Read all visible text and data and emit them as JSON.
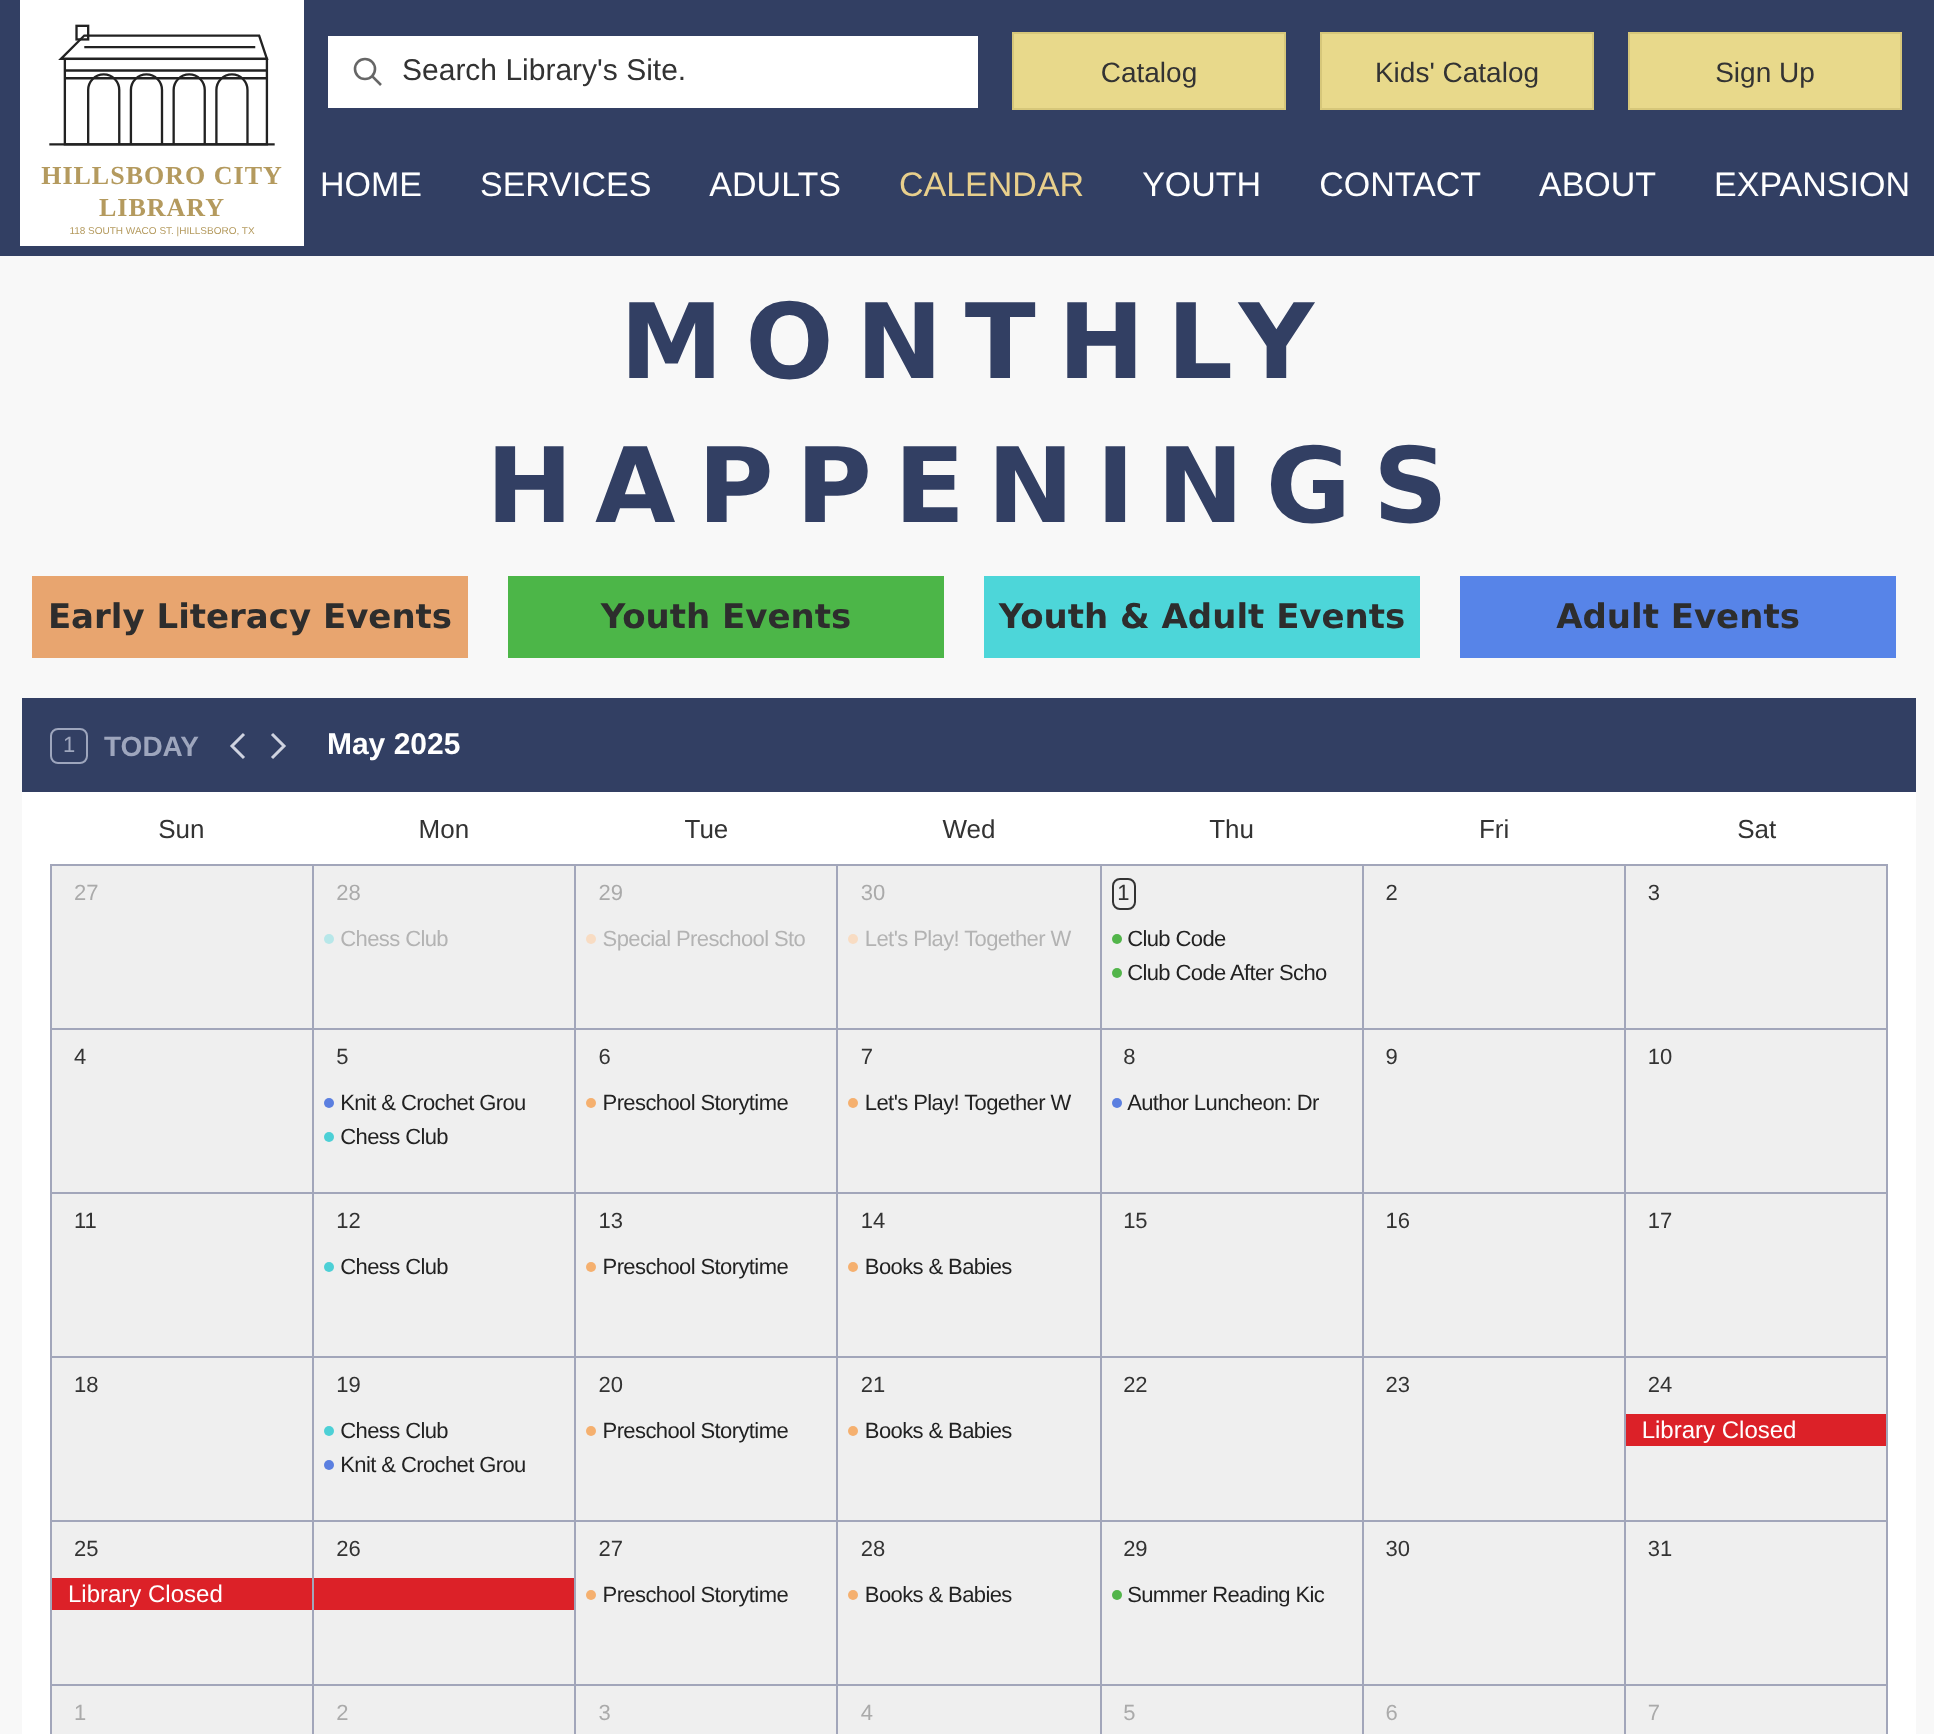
{
  "header": {
    "logo": {
      "line1": "HILLSBORO CITY",
      "line2": "LIBRARY",
      "address": "118 SOUTH WACO ST. |HILLSBORO, TX"
    },
    "search": {
      "placeholder": "Search Library's Site."
    },
    "buttons": [
      "Catalog",
      "Kids' Catalog",
      "Sign Up"
    ],
    "nav": [
      {
        "label": "HOME",
        "selected": false
      },
      {
        "label": "SERVICES",
        "selected": false
      },
      {
        "label": "ADULTS",
        "selected": false
      },
      {
        "label": "CALENDAR",
        "selected": true
      },
      {
        "label": "YOUTH",
        "selected": false
      },
      {
        "label": "CONTACT",
        "selected": false
      },
      {
        "label": "ABOUT",
        "selected": false
      },
      {
        "label": "EXPANSION",
        "selected": false
      }
    ]
  },
  "title_lines": [
    "MONTHLY",
    "HAPPENINGS"
  ],
  "legend": [
    {
      "label": "Early Literacy Events",
      "color": "#e8a56f"
    },
    {
      "label": "Youth Events",
      "color": "#4cb648"
    },
    {
      "label": "Youth & Adult Events",
      "color": "#4dd6d9"
    },
    {
      "label": "Adult Events",
      "color": "#5784e8"
    }
  ],
  "calendar": {
    "today_badge": "1",
    "today_label": "TODAY",
    "month": "May 2025",
    "weekdays": [
      "Sun",
      "Mon",
      "Tue",
      "Wed",
      "Thu",
      "Fri",
      "Sat"
    ],
    "weeks": [
      {
        "days": [
          {
            "date": "27",
            "outside": true,
            "today": false
          },
          {
            "date": "28",
            "outside": true,
            "today": false,
            "events": [
              {
                "title": "Chess Club",
                "color": "#b7e7e9"
              }
            ]
          },
          {
            "date": "29",
            "outside": true,
            "today": false,
            "events": [
              {
                "title": "Special Preschool Sto",
                "color": "#f8dcc3"
              }
            ]
          },
          {
            "date": "30",
            "outside": true,
            "today": false,
            "events": [
              {
                "title": "Let's Play! Together W",
                "color": "#f8dcc3"
              }
            ]
          },
          {
            "date": "1",
            "outside": false,
            "today": true,
            "events": [
              {
                "title": "Club Code",
                "color": "#52b54a"
              },
              {
                "title": "Club Code After Scho",
                "color": "#52b54a"
              }
            ]
          },
          {
            "date": "2",
            "outside": false,
            "today": false
          },
          {
            "date": "3",
            "outside": false,
            "today": false
          }
        ]
      },
      {
        "days": [
          {
            "date": "4",
            "outside": false,
            "today": false
          },
          {
            "date": "5",
            "outside": false,
            "today": false,
            "events": [
              {
                "title": "Knit & Crochet Grou",
                "color": "#5b7fe0"
              },
              {
                "title": "Chess Club",
                "color": "#4dd0d6"
              }
            ]
          },
          {
            "date": "6",
            "outside": false,
            "today": false,
            "events": [
              {
                "title": "Preschool Storytime",
                "color": "#f5b06f"
              }
            ]
          },
          {
            "date": "7",
            "outside": false,
            "today": false,
            "events": [
              {
                "title": "Let's Play! Together W",
                "color": "#f5b06f"
              }
            ]
          },
          {
            "date": "8",
            "outside": false,
            "today": false,
            "events": [
              {
                "title": "Author Luncheon: Dr",
                "color": "#5b7fe0"
              }
            ]
          },
          {
            "date": "9",
            "outside": false,
            "today": false
          },
          {
            "date": "10",
            "outside": false,
            "today": false
          }
        ]
      },
      {
        "days": [
          {
            "date": "11",
            "outside": false,
            "today": false
          },
          {
            "date": "12",
            "outside": false,
            "today": false,
            "events": [
              {
                "title": "Chess Club",
                "color": "#4dd0d6"
              }
            ]
          },
          {
            "date": "13",
            "outside": false,
            "today": false,
            "events": [
              {
                "title": "Preschool Storytime",
                "color": "#f5b06f"
              }
            ]
          },
          {
            "date": "14",
            "outside": false,
            "today": false,
            "events": [
              {
                "title": "Books & Babies",
                "color": "#f5b06f"
              }
            ]
          },
          {
            "date": "15",
            "outside": false,
            "today": false
          },
          {
            "date": "16",
            "outside": false,
            "today": false
          },
          {
            "date": "17",
            "outside": false,
            "today": false
          }
        ]
      },
      {
        "days": [
          {
            "date": "18",
            "outside": false,
            "today": false
          },
          {
            "date": "19",
            "outside": false,
            "today": false,
            "events": [
              {
                "title": "Chess Club",
                "color": "#4dd0d6"
              },
              {
                "title": "Knit & Crochet Grou",
                "color": "#5b7fe0"
              }
            ]
          },
          {
            "date": "20",
            "outside": false,
            "today": false,
            "events": [
              {
                "title": "Preschool Storytime",
                "color": "#f5b06f"
              }
            ]
          },
          {
            "date": "21",
            "outside": false,
            "today": false,
            "events": [
              {
                "title": "Books & Babies",
                "color": "#f5b06f"
              }
            ]
          },
          {
            "date": "22",
            "outside": false,
            "today": false
          },
          {
            "date": "23",
            "outside": false,
            "today": false
          },
          {
            "date": "24",
            "outside": false,
            "today": false,
            "banner": {
              "title": "Library Closed"
            }
          }
        ]
      },
      {
        "days": [
          {
            "date": "25",
            "outside": false,
            "today": false,
            "banner": {
              "title": "Library Closed"
            }
          },
          {
            "date": "26",
            "outside": false,
            "today": false,
            "banner": {
              "continued": true
            }
          },
          {
            "date": "27",
            "outside": false,
            "today": false,
            "events": [
              {
                "title": "Preschool Storytime",
                "color": "#f5b06f"
              }
            ]
          },
          {
            "date": "28",
            "outside": false,
            "today": false,
            "events": [
              {
                "title": "Books & Babies",
                "color": "#f5b06f"
              }
            ]
          },
          {
            "date": "29",
            "outside": false,
            "today": false,
            "events": [
              {
                "title": "Summer Reading Kic",
                "color": "#52b54a"
              }
            ]
          },
          {
            "date": "30",
            "outside": false,
            "today": false
          },
          {
            "date": "31",
            "outside": false,
            "today": false
          }
        ]
      },
      {
        "days": [
          {
            "date": "1",
            "outside": true,
            "today": false
          },
          {
            "date": "2",
            "outside": true,
            "today": false
          },
          {
            "date": "3",
            "outside": true,
            "today": false
          },
          {
            "date": "4",
            "outside": true,
            "today": false
          },
          {
            "date": "5",
            "outside": true,
            "today": false
          },
          {
            "date": "6",
            "outside": true,
            "today": false
          },
          {
            "date": "7",
            "outside": true,
            "today": false
          }
        ]
      }
    ]
  }
}
